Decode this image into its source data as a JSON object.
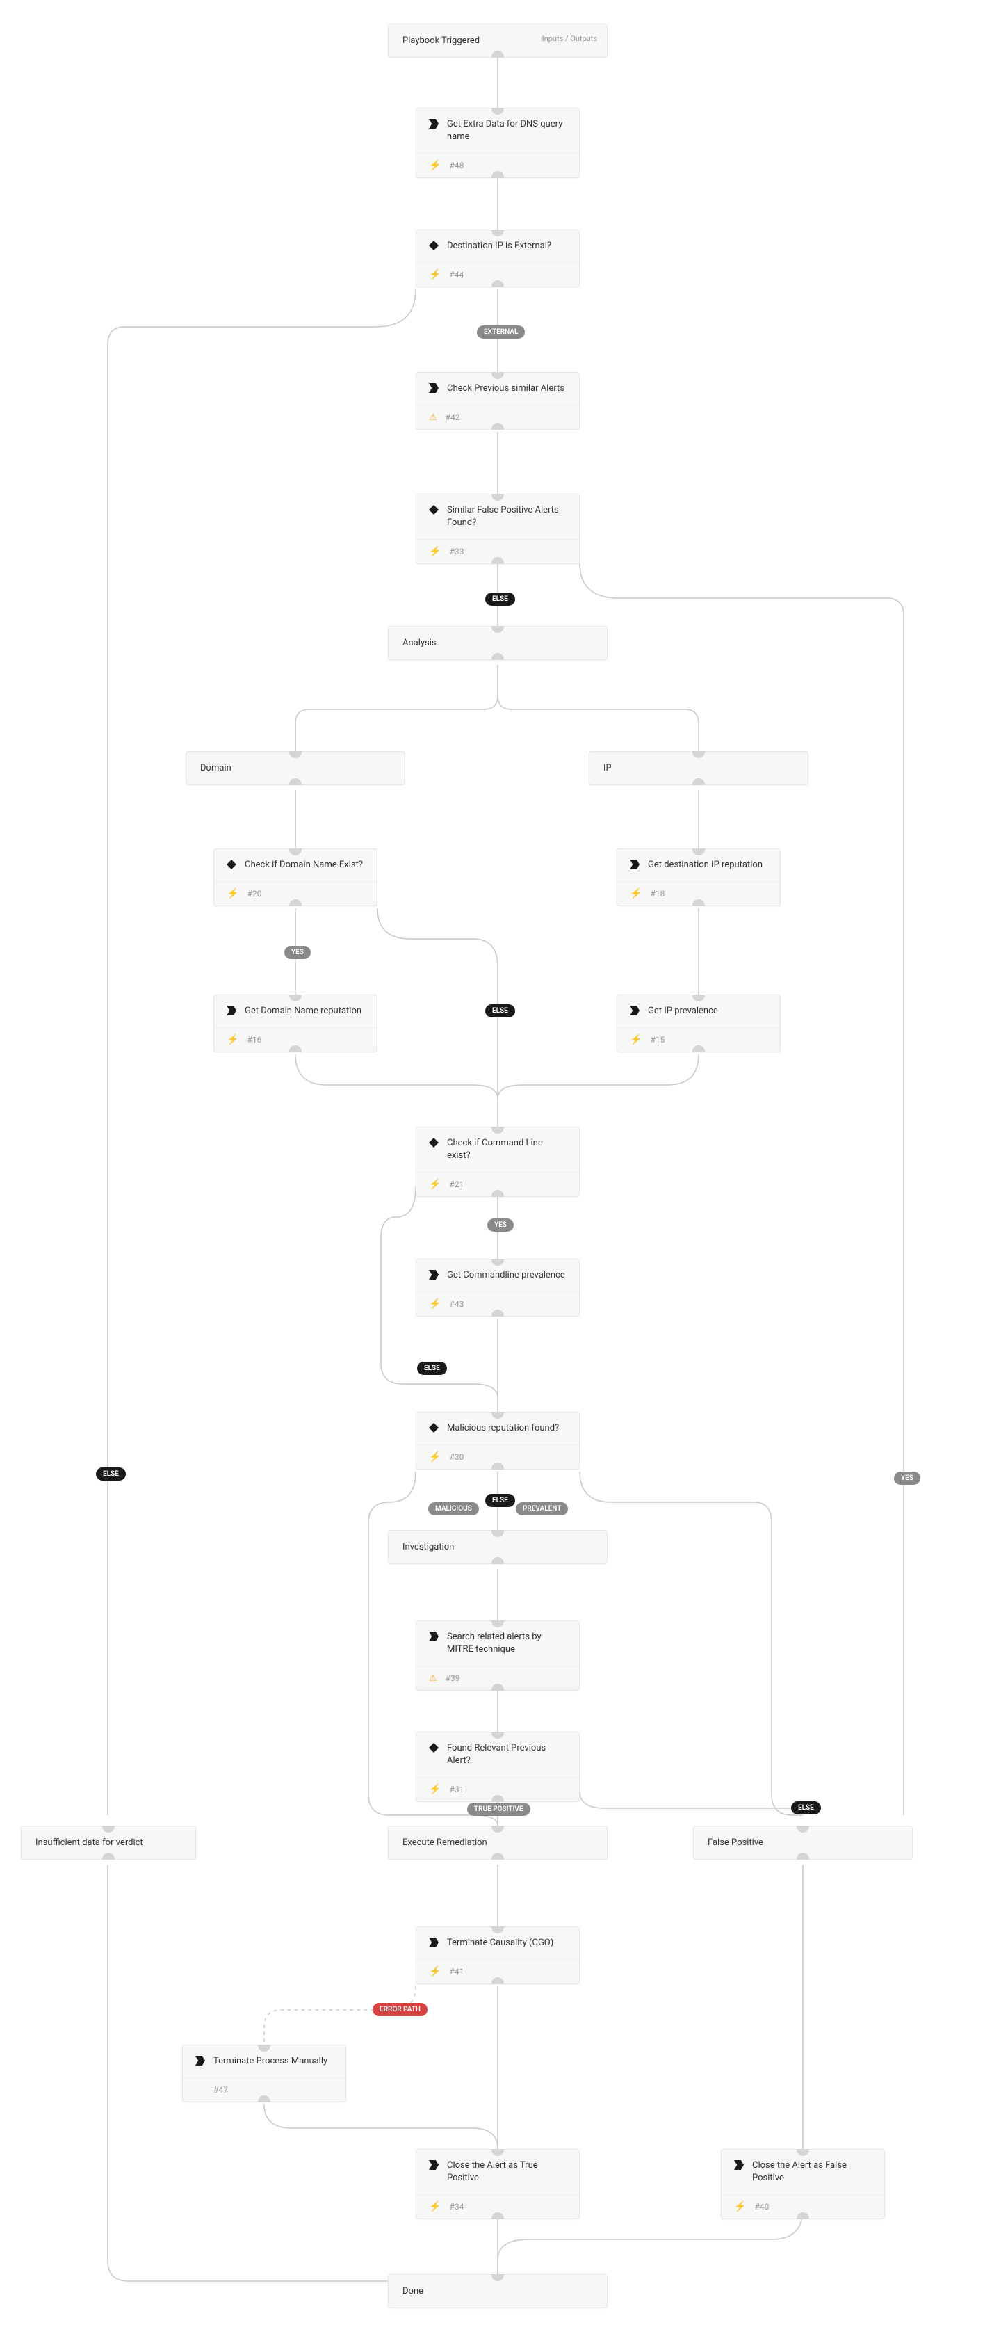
{
  "trigger": {
    "title": "Playbook Triggered",
    "io": "Inputs / Outputs"
  },
  "n48": {
    "title": "Get Extra Data for DNS query name",
    "num": "#48"
  },
  "n44": {
    "title": "Destination IP is External?",
    "num": "#44"
  },
  "n42": {
    "title": "Check Previous similar Alerts",
    "num": "#42"
  },
  "n33": {
    "title": "Similar False Positive Alerts Found?",
    "num": "#33"
  },
  "analysis": {
    "title": "Analysis"
  },
  "domain": {
    "title": "Domain"
  },
  "ip": {
    "title": "IP"
  },
  "n20": {
    "title": "Check if Domain Name Exist?",
    "num": "#20"
  },
  "n18": {
    "title": "Get destination IP reputation",
    "num": "#18"
  },
  "n16": {
    "title": "Get Domain Name reputation",
    "num": "#16"
  },
  "n15": {
    "title": "Get IP prevalence",
    "num": "#15"
  },
  "n21": {
    "title": "Check if Command Line exist?",
    "num": "#21"
  },
  "n43": {
    "title": "Get Commandline prevalence",
    "num": "#43"
  },
  "n30": {
    "title": "Malicious reputation found?",
    "num": "#30"
  },
  "investigation": {
    "title": "Investigation"
  },
  "n39": {
    "title": "Search related alerts by MITRE technique",
    "num": "#39"
  },
  "n31": {
    "title": "Found Relevant Previous Alert?",
    "num": "#31"
  },
  "insufficient": {
    "title": "Insufficient data for verdict"
  },
  "remediation": {
    "title": "Execute Remediation"
  },
  "falsepos": {
    "title": "False Positive"
  },
  "n41": {
    "title": "Terminate Causality (CGO)",
    "num": "#41"
  },
  "n47": {
    "title": "Terminate Process Manually",
    "num": "#47"
  },
  "n34": {
    "title": "Close the Alert as True Positive",
    "num": "#34"
  },
  "n40": {
    "title": "Close the Alert as False Positive",
    "num": "#40"
  },
  "done": {
    "title": "Done"
  },
  "labels": {
    "external": "EXTERNAL",
    "else": "ELSE",
    "yes": "YES",
    "malicious": "MALICIOUS",
    "prevalent": "PREVALENT",
    "true_positive": "TRUE POSITIVE",
    "error_path": "ERROR PATH"
  }
}
